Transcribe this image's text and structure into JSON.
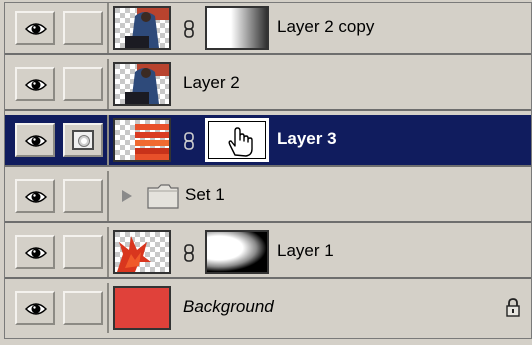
{
  "layers": [
    {
      "name": "Layer 2 copy"
    },
    {
      "name": "Layer 2"
    },
    {
      "name": "Layer 3"
    },
    {
      "name": "Set 1"
    },
    {
      "name": "Layer 1"
    },
    {
      "name": "Background"
    }
  ],
  "colors": {
    "selection": "#101c5e",
    "background_fill": "#e0413a",
    "panel": "#d4d0c8"
  },
  "icons": {
    "visibility": "eye-icon",
    "link": "chain-link-icon",
    "mask_edit": "layer-mask-indicator-icon",
    "group_expand": "triangle-right-icon",
    "group": "folder-icon",
    "lock": "lock-icon",
    "cursor": "hand-cursor-icon"
  }
}
